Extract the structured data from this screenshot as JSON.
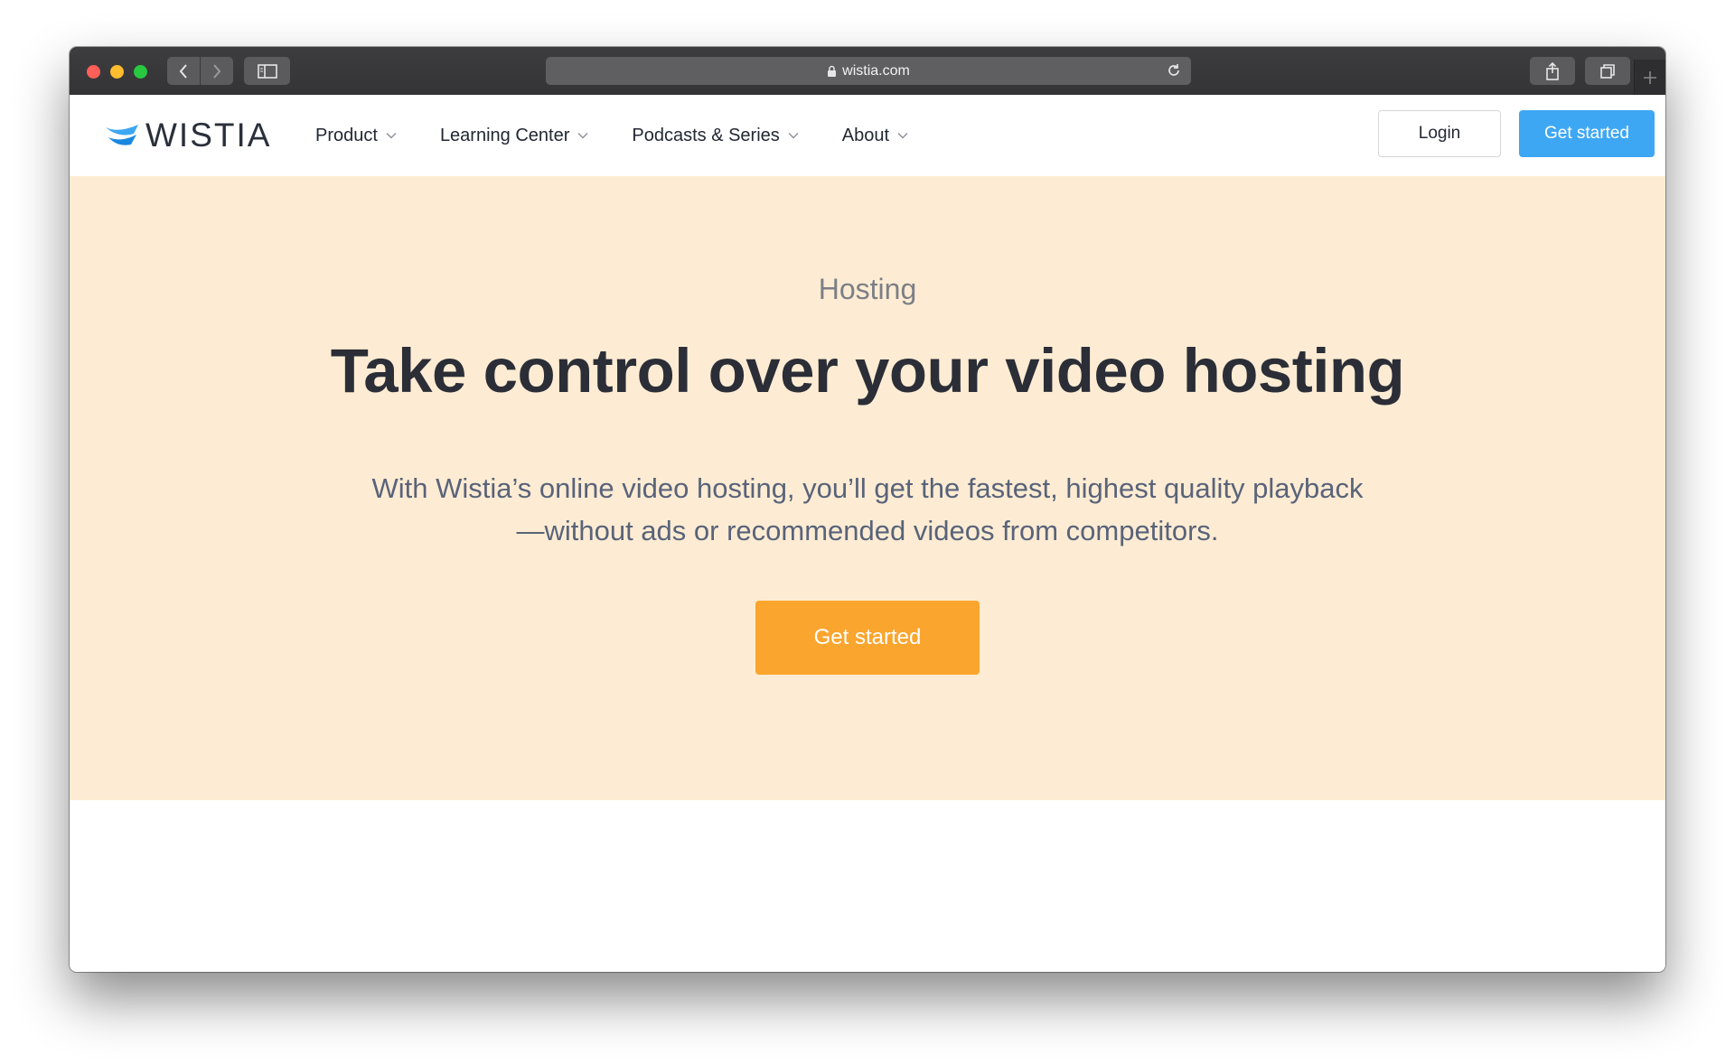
{
  "browser": {
    "url": "wistia.com",
    "icons": [
      "lock-icon",
      "reload-icon",
      "back-icon",
      "forward-icon",
      "sidebar-icon",
      "share-icon",
      "tabs-icon",
      "new-tab-icon"
    ]
  },
  "header": {
    "logo_text": "WISTIA",
    "menu": [
      {
        "label": "Product"
      },
      {
        "label": "Learning Center"
      },
      {
        "label": "Podcasts & Series"
      },
      {
        "label": "About"
      }
    ],
    "login_label": "Login",
    "cta_label": "Get started"
  },
  "hero": {
    "eyebrow": "Hosting",
    "headline": "Take control over your video hosting",
    "subhead": "With Wistia’s online video hosting, you’ll get the fastest, highest quality playback—without ads or recommended videos from competitors.",
    "cta_label": "Get started"
  },
  "colors": {
    "hero_bg": "#fdecd3",
    "nav_cta": "#3ea7f4",
    "hero_cta": "#faa52d",
    "logo_blue": "#3ea7f4"
  }
}
